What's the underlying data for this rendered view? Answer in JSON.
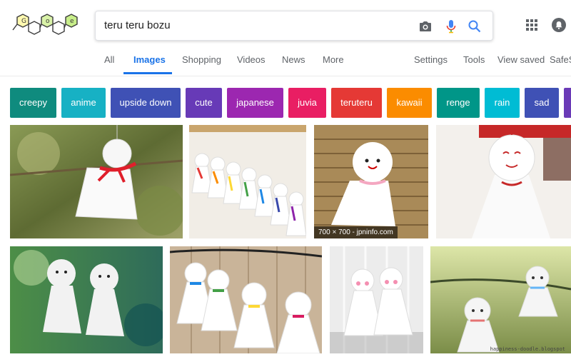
{
  "search": {
    "query": "teru teru bozu"
  },
  "icons": {
    "camera": "camera-icon",
    "mic": "microphone-icon",
    "search": "search-icon",
    "apps": "apps-grid-icon",
    "notifications": "notifications-icon"
  },
  "tabs": [
    "All",
    "Images",
    "Shopping",
    "Videos",
    "News",
    "More"
  ],
  "tools": {
    "settings": "Settings",
    "tools": "Tools",
    "view_saved": "View saved",
    "safesearch": "SafeS"
  },
  "chips": [
    {
      "label": "creepy",
      "color": "#0f8b7e"
    },
    {
      "label": "anime",
      "color": "#17b1c4"
    },
    {
      "label": "upside down",
      "color": "#3f51b5"
    },
    {
      "label": "cute",
      "color": "#673ab7"
    },
    {
      "label": "japanese",
      "color": "#9c27b0"
    },
    {
      "label": "juvia",
      "color": "#e91e63"
    },
    {
      "label": "teruteru",
      "color": "#e53935"
    },
    {
      "label": "kawaii",
      "color": "#fb8c00"
    },
    {
      "label": "renge",
      "color": "#009688"
    },
    {
      "label": "rain",
      "color": "#00bcd4"
    },
    {
      "label": "sad",
      "color": "#3f51b5"
    }
  ],
  "results": {
    "img3_overlay": "700 × 700 - jpninfo.com",
    "img8_watermark": "happiness-doodle.blogspot"
  }
}
